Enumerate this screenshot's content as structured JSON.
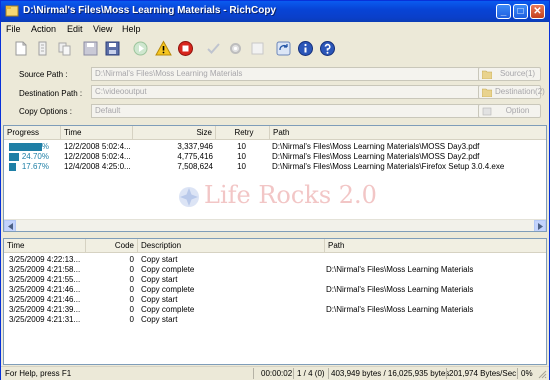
{
  "window": {
    "title": "D:\\Nirmal's Files\\Moss Learning Materials - RichCopy",
    "controls": {
      "minimize": "_",
      "maximize": "□",
      "close": "✕"
    }
  },
  "menu": [
    "File",
    "Action",
    "Edit",
    "View",
    "Help"
  ],
  "toolbar": {
    "icons": [
      "new-icon",
      "properties-icon",
      "copy-profile-icon",
      "save-icon",
      "save-as-icon",
      "start-icon",
      "warning-icon",
      "stop-icon",
      "check-icon",
      "settings-icon",
      "clear-icon",
      "refresh-icon",
      "info-icon",
      "about-icon"
    ]
  },
  "options": {
    "source_label": "Source Path :",
    "source_value": "D:\\Nirmal's Files\\Moss Learning Materials",
    "source_button": "Source(1)",
    "dest_label": "Destination Path :",
    "dest_value": "C:\\videooutput",
    "dest_button": "Destination(2)",
    "copy_label": "Copy Options :",
    "copy_value": "Default",
    "option_button": "Option"
  },
  "transfers": {
    "headers": [
      "Progress",
      "Time",
      "Size",
      "Retry",
      "Path"
    ],
    "rows": [
      {
        "progress": 81.9,
        "progress_label": "81.90%",
        "time": "12/2/2008 5:02:4...",
        "size": "3,337,946",
        "retry": "10",
        "path": "D:\\Nirmal's Files\\Moss Learning Materials\\MOSS Day3.pdf"
      },
      {
        "progress": 24.7,
        "progress_label": "24.70%",
        "time": "12/2/2008 5:02:4...",
        "size": "4,775,416",
        "retry": "10",
        "path": "D:\\Nirmal's Files\\Moss Learning Materials\\MOSS Day2.pdf"
      },
      {
        "progress": 17.67,
        "progress_label": "17.67%",
        "time": "12/4/2008 4:25:0...",
        "size": "7,508,624",
        "retry": "10",
        "path": "D:\\Nirmal's Files\\Moss Learning Materials\\Firefox Setup 3.0.4.exe"
      }
    ],
    "watermark": "Life Rocks 2.0",
    "progress_color": "#1E7FA6"
  },
  "log": {
    "headers": [
      "Time",
      "Code",
      "Description",
      "Path"
    ],
    "rows": [
      {
        "time": "3/25/2009 4:22:13...",
        "code": "0",
        "description": "Copy start",
        "path": ""
      },
      {
        "time": "3/25/2009 4:21:58...",
        "code": "0",
        "description": "Copy complete",
        "path": "D:\\Nirmal's Files\\Moss Learning Materials"
      },
      {
        "time": "3/25/2009 4:21:55...",
        "code": "0",
        "description": "Copy start",
        "path": ""
      },
      {
        "time": "3/25/2009 4:21:46...",
        "code": "0",
        "description": "Copy complete",
        "path": "D:\\Nirmal's Files\\Moss Learning Materials"
      },
      {
        "time": "3/25/2009 4:21:46...",
        "code": "0",
        "description": "Copy start",
        "path": ""
      },
      {
        "time": "3/25/2009 4:21:39...",
        "code": "0",
        "description": "Copy complete",
        "path": "D:\\Nirmal's Files\\Moss Learning Materials"
      },
      {
        "time": "3/25/2009 4:21:31...",
        "code": "0",
        "description": "Copy start",
        "path": ""
      }
    ]
  },
  "status": {
    "help": "For Help, press F1",
    "elapsed": "00:00:02",
    "count": "1 / 4 (0)",
    "bytes": "403,949 bytes / 16,025,935 bytes",
    "rate": "201,974 Bytes/Sec",
    "percent": "0%"
  },
  "colors": {
    "titlebar": "#0A5BF0",
    "accent": "#1E7FA6",
    "chrome": "#ECE9D8"
  }
}
